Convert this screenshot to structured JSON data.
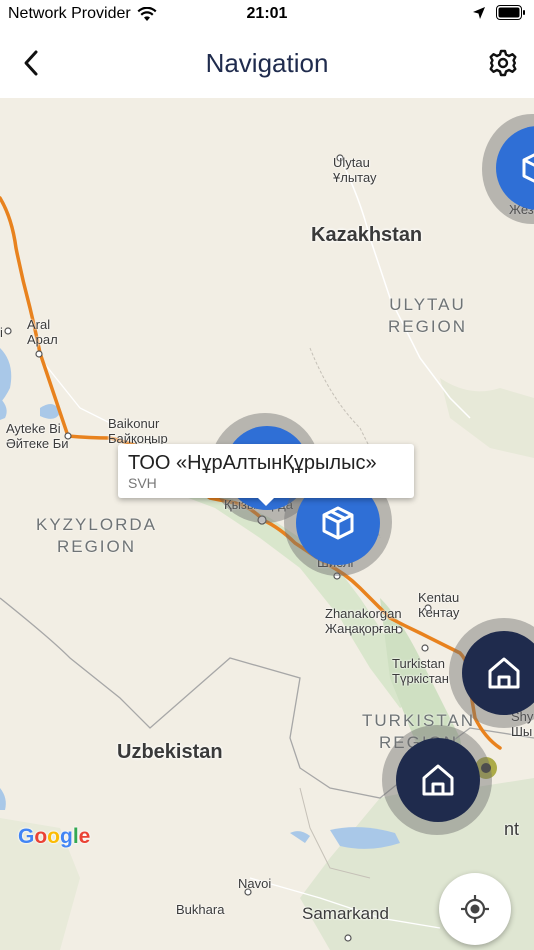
{
  "status_bar": {
    "carrier": "Network Provider",
    "time": "21:01"
  },
  "header": {
    "title": "Navigation"
  },
  "map": {
    "countries": [
      "Kazakhstan",
      "Uzbekistan"
    ],
    "regions": {
      "ulytau": [
        "ULYTAU",
        "REGION"
      ],
      "kyzylorda": [
        "KYZYLORDA",
        "REGION"
      ],
      "turkistan": [
        "TURKISTAN",
        "REGION"
      ]
    },
    "cities": {
      "ulytau_lat": "Ulytau",
      "ulytau_cyr": "Ұлытау",
      "aral_lat": "Aral",
      "aral_cyr": "Арал",
      "baikonur_lat": "Baikonur",
      "baikonur_cyr": "Байқоңыр",
      "ayteke_lat": "Ayteke Bi",
      "ayteke_cyr": "Әйтеке Би",
      "kyzylorda_partial": "Қызылорда",
      "shieli_partial": "Шиелі",
      "zhanakorgan_lat": "Zhanakorgan",
      "zhanakorgan_cyr": "Жаңақорған",
      "kentau_lat": "Kentau",
      "kentau_cyr": "Кентау",
      "turkistan_lat": "Turkistan",
      "turkistan_cyr": "Түркістан",
      "shymkent_lat_partial": "Shy",
      "shymkent_cyr_partial": "Шы",
      "tashkent_partial": "nt",
      "zhez_partial": "Жез",
      "navoi": "Navoi",
      "bukhara": "Bukhara",
      "samarkand": "Samarkand",
      "left_edge_i": "i"
    },
    "callout": {
      "title": "ТОО «НұрАлтынҚұрылыс»",
      "subtitle": "SVH"
    },
    "markers": [
      {
        "type": "warehouse",
        "color": "#2f6fd6"
      },
      {
        "type": "warehouse",
        "color": "#2f6fd6"
      },
      {
        "type": "warehouse",
        "color": "#2f6fd6"
      },
      {
        "type": "home",
        "color": "#1f2b4d"
      },
      {
        "type": "home",
        "color": "#1f2b4d"
      }
    ],
    "attribution": "Google",
    "route_color": "#e8821e"
  }
}
